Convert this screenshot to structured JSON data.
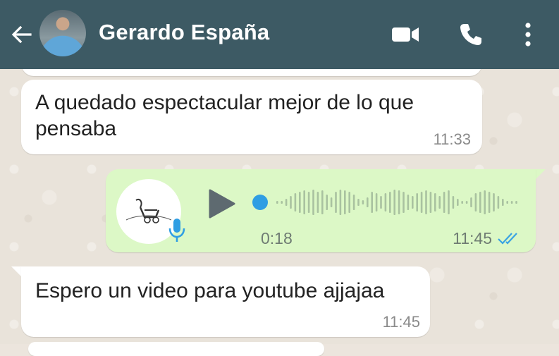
{
  "header": {
    "contact_name": "Gerardo España",
    "icons": [
      "back-arrow-icon",
      "video-call-icon",
      "phone-icon",
      "more-options-icon"
    ]
  },
  "messages": [
    {
      "direction": "incoming",
      "text": "A quedado espectacular mejor de lo que pensaba",
      "time": "11:33"
    },
    {
      "direction": "outgoing",
      "type": "voice",
      "duration": "0:18",
      "time": "11:45",
      "status": "read",
      "playback_progress": 0
    },
    {
      "direction": "incoming",
      "text": "Espero un video para youtube ajjajaa",
      "time": "11:45"
    }
  ],
  "colors": {
    "header": "#3d5a64",
    "incoming_bubble": "#ffffff",
    "outgoing_bubble": "#dcf8c6",
    "accent_blue": "#2f9ee3",
    "chat_background": "#e9e3da"
  }
}
